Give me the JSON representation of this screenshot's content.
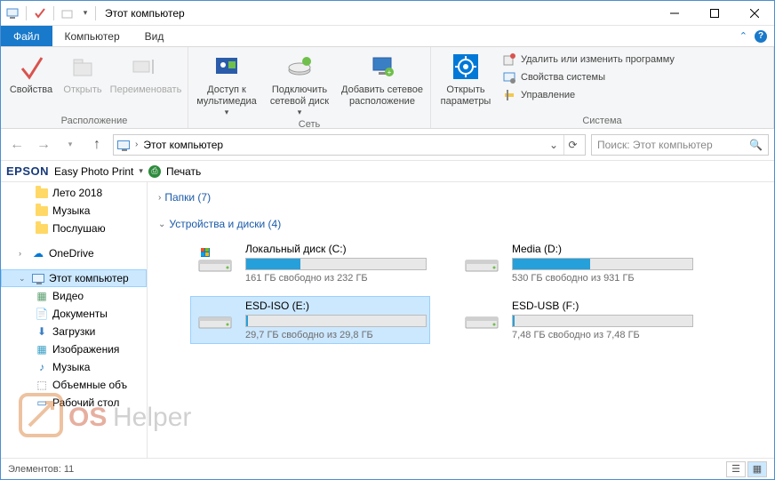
{
  "titlebar": {
    "title": "Этот компьютер"
  },
  "tabs": {
    "file": "Файл",
    "computer": "Компьютер",
    "view": "Вид"
  },
  "ribbon": {
    "group_location": "Расположение",
    "group_network": "Сеть",
    "group_system": "Система",
    "properties": "Свойства",
    "open": "Открыть",
    "rename": "Переименовать",
    "media_access": "Доступ к\nмультимедиа",
    "map_drive": "Подключить\nсетевой диск",
    "add_net": "Добавить сетевое\nрасположение",
    "open_params": "Открыть\nпараметры",
    "uninstall": "Удалить или изменить программу",
    "sys_props": "Свойства системы",
    "manage": "Управление"
  },
  "address": {
    "location": "Этот компьютер"
  },
  "search": {
    "placeholder": "Поиск: Этот компьютер"
  },
  "epson": {
    "brand": "EPSON",
    "app": "Easy Photo Print",
    "print": "Печать"
  },
  "sidebar": {
    "leto": "Лето 2018",
    "music": "Музыка",
    "listen": "Послушаю",
    "onedrive": "OneDrive",
    "thispc": "Этот компьютер",
    "video": "Видео",
    "docs": "Документы",
    "downloads": "Загрузки",
    "images": "Изображения",
    "music2": "Музыка",
    "volumes": "Объемные объ",
    "desktop": "Рабочий стол"
  },
  "content": {
    "folders_header": "Папки (7)",
    "drives_header": "Устройства и диски (4)",
    "drives": [
      {
        "name": "Локальный диск (C:)",
        "free": "161 ГБ свободно из 232 ГБ",
        "fill": 30,
        "os": true
      },
      {
        "name": "Media (D:)",
        "free": "530 ГБ свободно из 931 ГБ",
        "fill": 43
      },
      {
        "name": "ESD-ISO (E:)",
        "free": "29,7 ГБ свободно из 29,8 ГБ",
        "fill": 1,
        "selected": true
      },
      {
        "name": "ESD-USB (F:)",
        "free": "7,48 ГБ свободно из 7,48 ГБ",
        "fill": 1
      }
    ]
  },
  "status": {
    "items": "Элементов: 11"
  }
}
